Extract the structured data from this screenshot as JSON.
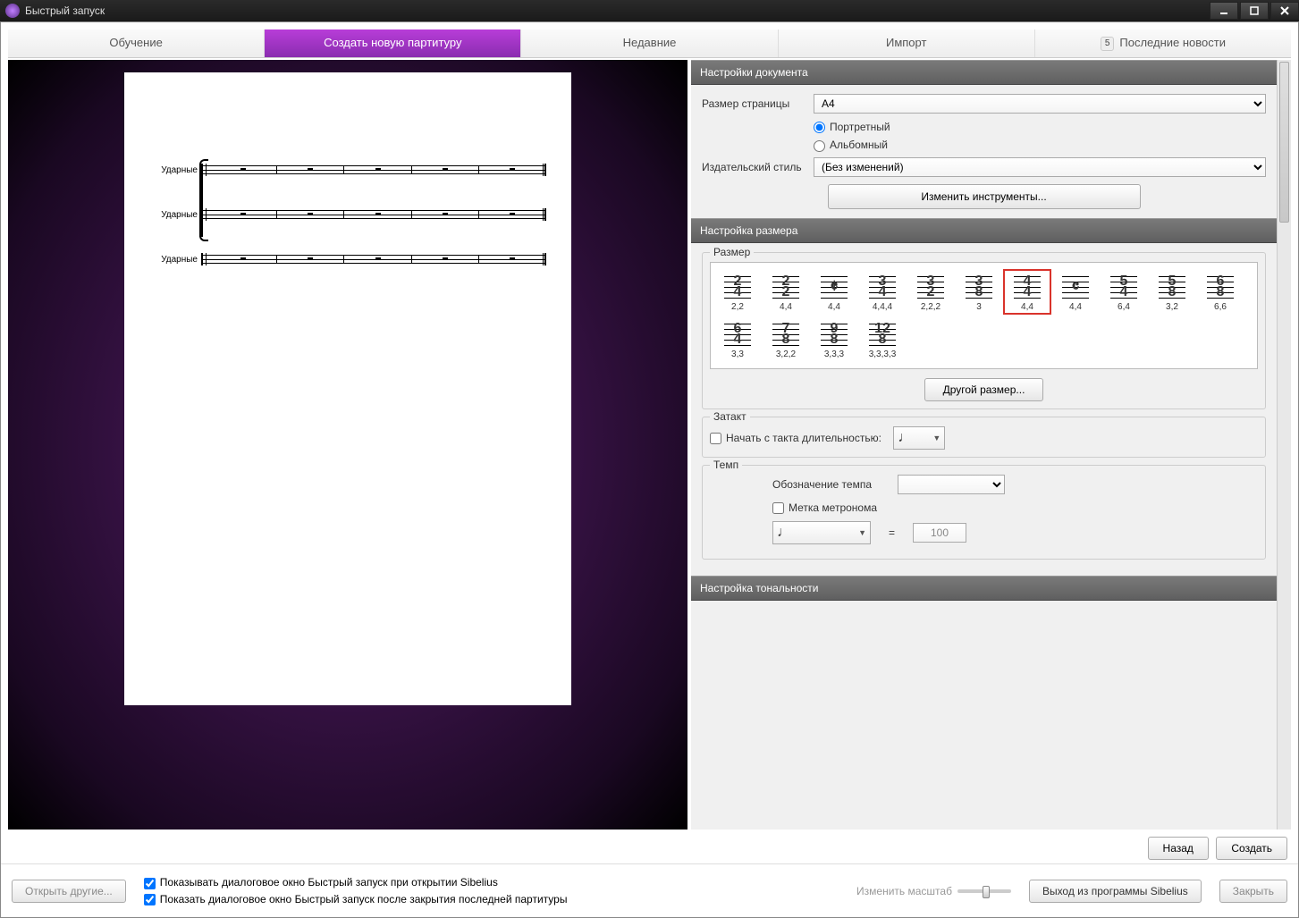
{
  "window": {
    "title": "Быстрый запуск"
  },
  "tabs": {
    "learn": "Обучение",
    "new": "Создать новую партитуру",
    "recent": "Недавние",
    "import": "Импорт",
    "news": "Последние новости",
    "news_badge": "5"
  },
  "preview": {
    "instrument_label": "Ударные"
  },
  "doc": {
    "header": "Настройки документа",
    "page_size_label": "Размер страницы",
    "page_size_value": "A4",
    "orient_portrait": "Портретный",
    "orient_landscape": "Альбомный",
    "house_style_label": "Издательский стиль",
    "house_style_value": "(Без изменений)",
    "change_instruments": "Изменить инструменты..."
  },
  "timesig": {
    "header": "Настройка размера",
    "legend": "Размер",
    "items": [
      {
        "top": "2",
        "bot": "4",
        "cap": "2,2"
      },
      {
        "top": "2",
        "bot": "2",
        "cap": "4,4"
      },
      {
        "c": "𝄵",
        "cap": "4,4"
      },
      {
        "top": "3",
        "bot": "4",
        "cap": "4,4,4"
      },
      {
        "top": "3",
        "bot": "2",
        "cap": "2,2,2"
      },
      {
        "top": "3",
        "bot": "8",
        "cap": "3"
      },
      {
        "top": "4",
        "bot": "4",
        "cap": "4,4",
        "selected": true
      },
      {
        "c": "𝄴",
        "cap": "4,4"
      },
      {
        "top": "5",
        "bot": "4",
        "cap": "6,4"
      },
      {
        "top": "5",
        "bot": "8",
        "cap": "3,2"
      },
      {
        "top": "6",
        "bot": "8",
        "cap": "6,6"
      },
      {
        "top": "6",
        "bot": "4",
        "cap": "3,3"
      },
      {
        "top": "7",
        "bot": "8",
        "cap": "3,2,2"
      },
      {
        "top": "9",
        "bot": "8",
        "cap": "3,3,3"
      },
      {
        "top": "12",
        "bot": "8",
        "cap": "3,3,3,3"
      }
    ],
    "other": "Другой размер..."
  },
  "pickup": {
    "legend": "Затакт",
    "label": "Начать с такта длительностью:"
  },
  "tempo": {
    "legend": "Темп",
    "text_label": "Обозначение темпа",
    "metronome_label": "Метка метронома",
    "equals": "=",
    "value": "100"
  },
  "key": {
    "header": "Настройка тональности"
  },
  "nav": {
    "back": "Назад",
    "create": "Создать"
  },
  "footer": {
    "open_other": "Открыть другие...",
    "show_on_start": "Показывать диалоговое окно Быстрый запуск при открытии Sibelius",
    "show_after_close": "Показать диалоговое окно Быстрый запуск после закрытия последней партитуры",
    "zoom_label": "Изменить масштаб",
    "exit": "Выход из программы Sibelius",
    "close": "Закрыть"
  }
}
